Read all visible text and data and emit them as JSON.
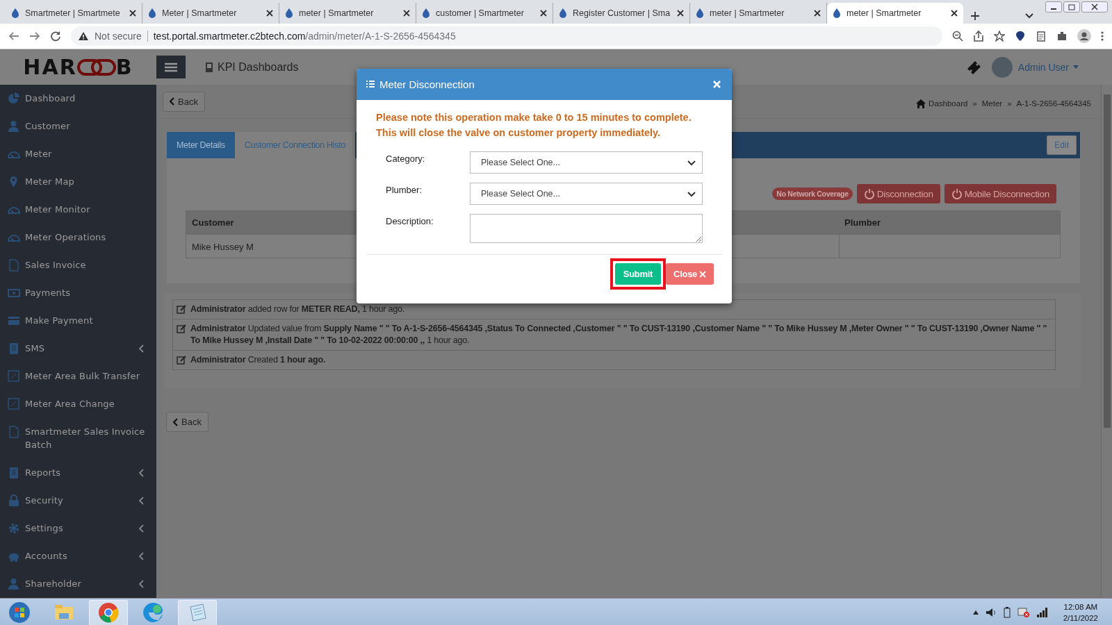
{
  "browser": {
    "tabs": [
      {
        "title": "Smartmeter | Smartmete",
        "selected": false
      },
      {
        "title": "Meter | Smartmeter",
        "selected": false
      },
      {
        "title": "meter | Smartmeter",
        "selected": false
      },
      {
        "title": "customer | Smartmeter",
        "selected": false
      },
      {
        "title": "Register Customer | Sma",
        "selected": false
      },
      {
        "title": "meter | Smartmeter",
        "selected": false
      },
      {
        "title": "meter | Smartmeter",
        "selected": true
      }
    ],
    "security_label": "Not secure",
    "url_host": "test.portal.smartmeter.c2btech.com",
    "url_path": "/admin/meter/A-1-S-2656-4564345"
  },
  "header": {
    "logo_start": "HAR",
    "logo_end": "B",
    "title": "KPI Dashboards",
    "user": "Admin User"
  },
  "sidebar": {
    "items": [
      {
        "label": "Dashboard",
        "submenu": false
      },
      {
        "label": "Customer",
        "submenu": false
      },
      {
        "label": "Meter",
        "submenu": false
      },
      {
        "label": "Meter Map",
        "submenu": false
      },
      {
        "label": "Meter Monitor",
        "submenu": false
      },
      {
        "label": "Meter Operations",
        "submenu": false
      },
      {
        "label": "Sales Invoice",
        "submenu": false
      },
      {
        "label": "Payments",
        "submenu": false
      },
      {
        "label": "Make Payment",
        "submenu": false
      },
      {
        "label": "SMS",
        "submenu": true
      },
      {
        "label": "Meter Area Bulk Transfer",
        "submenu": false
      },
      {
        "label": "Meter Area Change",
        "submenu": false
      },
      {
        "label": "Smartmeter Sales Invoice Batch",
        "submenu": false
      },
      {
        "label": "Reports",
        "submenu": true
      },
      {
        "label": "Security",
        "submenu": true
      },
      {
        "label": "Settings",
        "submenu": true
      },
      {
        "label": "Accounts",
        "submenu": true
      },
      {
        "label": "Shareholder",
        "submenu": true
      }
    ]
  },
  "back_top": "Back",
  "breadcrumb": [
    {
      "kind": "link",
      "text": "Dashboard"
    },
    {
      "kind": "separator",
      "text": "»"
    },
    {
      "kind": "link",
      "text": "Meter"
    },
    {
      "kind": "separator",
      "text": "»"
    },
    {
      "kind": "current",
      "text": "A-1-S-2656-4564345"
    }
  ],
  "detail_tabs": [
    {
      "label": "Meter Details",
      "selected": true
    },
    {
      "label": "Customer Connection Histo",
      "selected": false
    }
  ],
  "edit_button": "Edit",
  "status_badge": "No Network Coverage",
  "action_buttons": [
    "Disconnection",
    "Mobile Disconnection"
  ],
  "table": {
    "columns": [
      "Customer",
      "Plumber"
    ],
    "rows": [
      [
        "Mike Hussey M"
      ]
    ]
  },
  "activity": [
    {
      "text": "**Administrator** added row for **METER READ,** 1 hour ago."
    },
    {
      "text": "**Administrator** Updated value from **Supply Name \" \" To A-1-S-2656-4564345 ,Status To Connected ,Customer \" \" To CUST-13190 ,Customer Name \" \" To Mike Hussey M ,Meter Owner \" \" To CUST-13190 ,Owner Name \" \" To Mike Hussey M ,Install Date \" \" To 10-02-2022 00:00:00 ,,** 1 hour ago."
    },
    {
      "text": "**Administrator** Created **1 hour ago.**"
    }
  ],
  "back_bottom": "Back",
  "modal": {
    "title": "Meter Disconnection",
    "notice": [
      "Please note this operation make take 0 to 15 minutes to complete.",
      "This will close the valve on customer property immediately."
    ],
    "fields": [
      {
        "kind": "select",
        "label": "Category:",
        "value": "Please Select One..."
      },
      {
        "kind": "select",
        "label": "Plumber:",
        "value": "Please Select One..."
      },
      {
        "kind": "textarea",
        "label": "Description:"
      }
    ],
    "submit": "Submit",
    "submit_highlighted": true,
    "close": "Close"
  },
  "taskbar": {
    "apps": [
      {
        "open": false
      },
      {
        "open": true
      },
      {
        "open": false
      },
      {
        "open": true
      }
    ],
    "time": "12:08 AM",
    "date": "2/11/2022"
  }
}
